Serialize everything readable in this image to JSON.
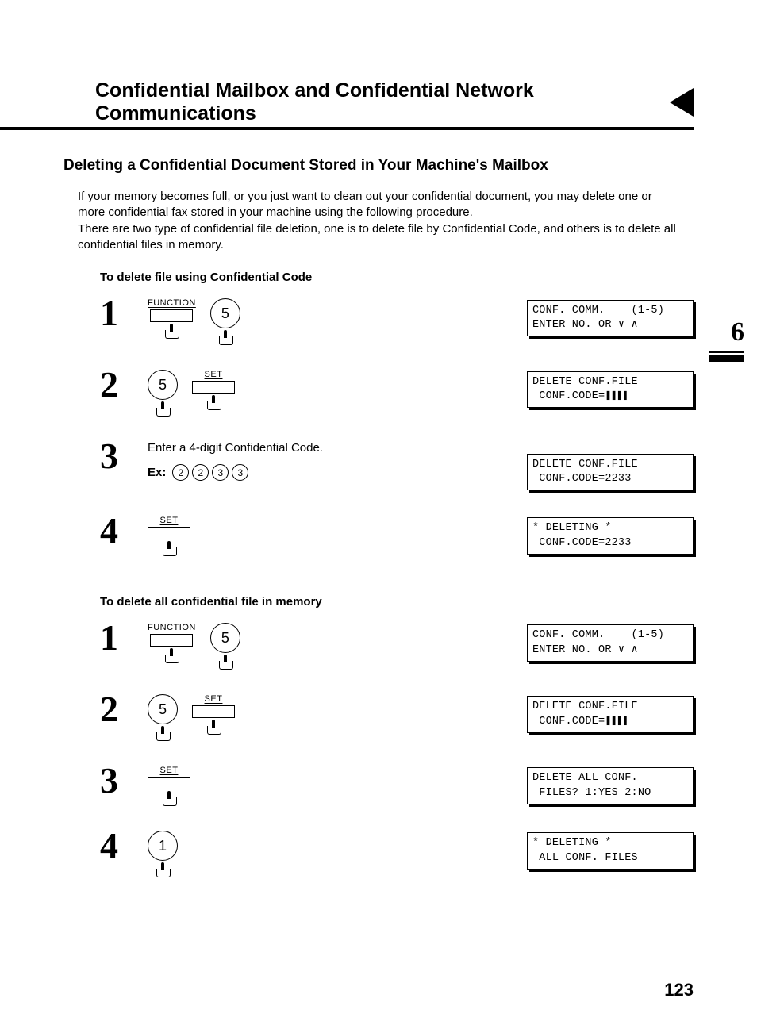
{
  "header": {
    "title": "Confidential Mailbox and Confidential Network Communications"
  },
  "subhead": "Deleting a Confidential Document Stored in Your Machine's Mailbox",
  "intro": "If your memory becomes full, or you just want to clean out your confidential document, you may delete one or more confidential fax stored in your machine using the following procedure.\nThere are two type of confidential file deletion, one is to delete file by Confidential Code, and others is to delete all confidential files in memory.",
  "section_a": {
    "label": "To delete file using Confidential Code",
    "steps": [
      {
        "num": "1",
        "keys": {
          "function_label": "FUNCTION",
          "circle_digit": "5"
        },
        "lcd": "CONF. COMM.    (1-5)\nENTER NO. OR ∨ ∧"
      },
      {
        "num": "2",
        "keys": {
          "circle_digit": "5",
          "set_label": "SET"
        },
        "lcd": "DELETE CONF.FILE\n CONF.CODE=",
        "lcd_blocks": "❚❚❚❚"
      },
      {
        "num": "3",
        "instruction": "Enter a 4-digit Confidential Code.",
        "example_label": "Ex:",
        "example_digits": [
          "2",
          "2",
          "3",
          "3"
        ],
        "lcd": "DELETE CONF.FILE\n CONF.CODE=2233"
      },
      {
        "num": "4",
        "keys": {
          "set_label": "SET"
        },
        "lcd": "* DELETING *\n CONF.CODE=2233"
      }
    ]
  },
  "section_b": {
    "label": "To delete all confidential file in memory",
    "steps": [
      {
        "num": "1",
        "keys": {
          "function_label": "FUNCTION",
          "circle_digit": "5"
        },
        "lcd": "CONF. COMM.    (1-5)\nENTER NO. OR ∨ ∧"
      },
      {
        "num": "2",
        "keys": {
          "circle_digit": "5",
          "set_label": "SET"
        },
        "lcd": "DELETE CONF.FILE\n CONF.CODE=",
        "lcd_blocks": "❚❚❚❚"
      },
      {
        "num": "3",
        "keys": {
          "set_label": "SET"
        },
        "lcd": "DELETE ALL CONF.\n FILES? 1:YES 2:NO"
      },
      {
        "num": "4",
        "keys": {
          "circle_digit": "1"
        },
        "lcd": "* DELETING *\n ALL CONF. FILES"
      }
    ]
  },
  "chapter_tab": "6",
  "page_number": "123"
}
